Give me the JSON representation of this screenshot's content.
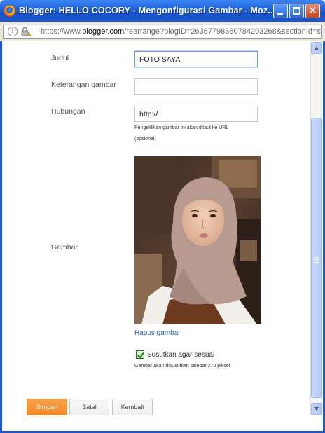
{
  "window": {
    "title": "Blogger: HELLO COCORY - Mengonfigurasi Gambar - Moz...",
    "minimize_label": "",
    "maximize_label": "",
    "close_label": "✕"
  },
  "addressbar": {
    "url_prefix": "https://www.",
    "url_host": "blogger.com",
    "url_rest": "/rearrange?blogID=26367798650784203268&sectionId=s"
  },
  "form": {
    "title_label": "Judul",
    "title_value": "FOTO SAYA",
    "caption_label": "Keterangan gambar",
    "caption_value": "",
    "link_label": "Hubungan",
    "link_value": "http://",
    "link_hint": "Pengeklikan gambar ini akan ditaut ke URL",
    "link_hint_optional": "(opsional)",
    "image_label": "Gambar",
    "remove_image_link": "Hapus gambar",
    "shrink_checkbox_label": "Susutkan agar sesuai",
    "shrink_checked": true,
    "shrink_note": "Gambar akan disusutkan selebar 270 piksel."
  },
  "buttons": {
    "save": "Simpan",
    "cancel": "Batal",
    "back": "Kembali"
  },
  "icons": {
    "app": "firefox-icon",
    "info": "info-icon",
    "lock": "lock-warning-icon",
    "check": "checkmark-icon"
  },
  "colors": {
    "titlebar": "#1f5fd8",
    "primary_button": "#f38a26",
    "link": "#2a5db0"
  }
}
